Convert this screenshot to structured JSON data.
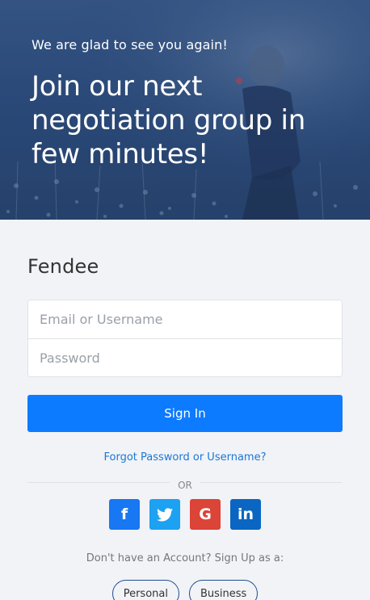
{
  "hero": {
    "subtitle": "We are glad to see you again!",
    "title": "Join our next negotiation group in few minutes!"
  },
  "brand": "Fendee",
  "form": {
    "email_placeholder": "Email or Username",
    "password_placeholder": "Password",
    "signin_label": "Sign In",
    "forgot_label": "Forgot Password or Username?"
  },
  "divider_label": "OR",
  "social": {
    "facebook": "f",
    "twitter": "twitter-bird",
    "google": "G",
    "linkedin": "in"
  },
  "signup": {
    "note": "Don't have an Account? Sign Up as a:",
    "personal_label": "Personal",
    "business_label": "Business"
  },
  "colors": {
    "primary": "#0d7bff",
    "facebook": "#1877f2",
    "twitter": "#1da1f2",
    "google": "#db4437",
    "linkedin": "#0a66c2"
  }
}
